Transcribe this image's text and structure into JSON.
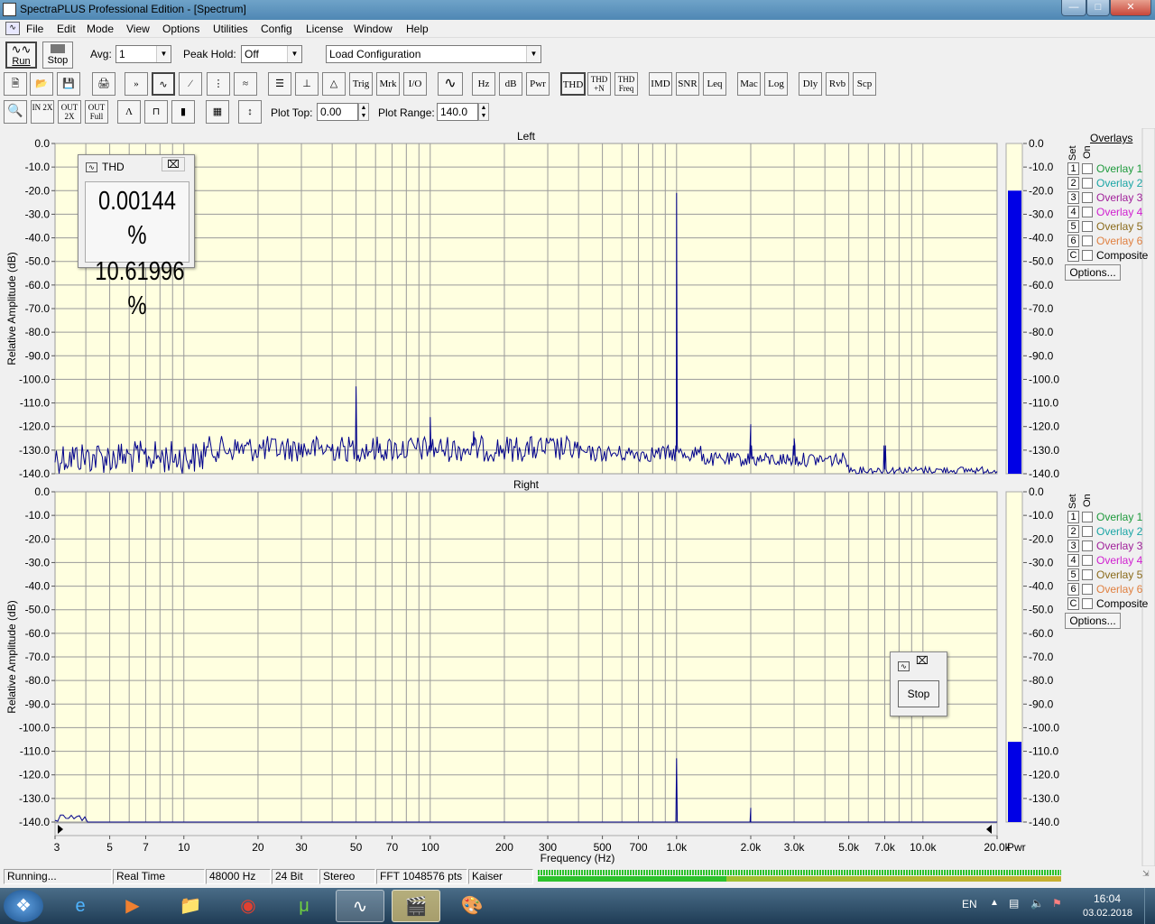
{
  "window": {
    "title": "SpectraPLUS Professional Edition - [Spectrum]"
  },
  "menu": [
    "File",
    "Edit",
    "Mode",
    "View",
    "Options",
    "Utilities",
    "Config",
    "License",
    "Window",
    "Help"
  ],
  "toolbar1": {
    "run_label": "Run",
    "stop_label": "Stop",
    "avg_label": "Avg:",
    "avg_value": "1",
    "peak_hold_label": "Peak Hold:",
    "peak_hold_value": "Off",
    "config_value": "Load Configuration"
  },
  "toolbar2": {
    "buttons": [
      "Trig",
      "Mrk",
      "I/O",
      "Hz",
      "dB",
      "Pwr",
      "THD",
      "THD +N",
      "THD Freq",
      "IMD",
      "SNR",
      "Leq",
      "Mac",
      "Log",
      "Dly",
      "Rvb",
      "Scp"
    ]
  },
  "toolbar3": {
    "zoom_labels": [
      "IN 2X",
      "OUT 2X",
      "OUT Full"
    ],
    "plot_top_label": "Plot Top:",
    "plot_top_value": "0.00",
    "plot_range_label": "Plot Range:",
    "plot_range_value": "140.0"
  },
  "plots": {
    "left_title": "Left",
    "right_title": "Right",
    "y_label": "Relative Amplitude (dB)",
    "x_label": "Frequency (Hz)",
    "pwr_label": "Pwr",
    "y_ticks": [
      "0.0",
      "-10.0",
      "-20.0",
      "-30.0",
      "-40.0",
      "-50.0",
      "-60.0",
      "-70.0",
      "-80.0",
      "-90.0",
      "-100.0",
      "-110.0",
      "-120.0",
      "-130.0",
      "-140.0"
    ],
    "x_ticks": [
      "3",
      "5",
      "7",
      "10",
      "20",
      "30",
      "50",
      "70",
      "100",
      "200",
      "300",
      "500",
      "700",
      "1.0k",
      "2.0k",
      "3.0k",
      "5.0k",
      "7.0k",
      "10.0k",
      "20.0k"
    ]
  },
  "chart_data": [
    {
      "type": "line",
      "title": "Left",
      "xlabel": "Frequency (Hz)",
      "ylabel": "Relative Amplitude (dB)",
      "xscale": "log",
      "xlim": [
        3,
        20000
      ],
      "ylim": [
        -140,
        0
      ],
      "grid": true,
      "series": [
        {
          "peaks": [
            [
              50,
              -103
            ],
            [
              100,
              -116
            ],
            [
              150,
              -122
            ],
            [
              1000,
              -21
            ],
            [
              2000,
              -119
            ],
            [
              3000,
              -125
            ],
            [
              7000,
              -136
            ]
          ],
          "floor_db": -130
        }
      ],
      "pwr_meter_db": -20
    },
    {
      "type": "line",
      "title": "Right",
      "xlabel": "Frequency (Hz)",
      "ylabel": "Relative Amplitude (dB)",
      "xscale": "log",
      "xlim": [
        3,
        20000
      ],
      "ylim": [
        -140,
        0
      ],
      "grid": true,
      "series": [
        {
          "peaks": [
            [
              1000,
              -113
            ],
            [
              2000,
              -134
            ]
          ],
          "floor_db": -140
        }
      ],
      "pwr_meter_db": -106
    }
  ],
  "overlays": {
    "header": "Overlays",
    "set_label": "Set",
    "on_label": "On",
    "items": [
      {
        "num": "1",
        "name": "Overlay 1",
        "color": "#1e9a3c"
      },
      {
        "num": "2",
        "name": "Overlay 2",
        "color": "#1aa5a5"
      },
      {
        "num": "3",
        "name": "Overlay 3",
        "color": "#a0209a"
      },
      {
        "num": "4",
        "name": "Overlay 4",
        "color": "#d020d0"
      },
      {
        "num": "5",
        "name": "Overlay 5",
        "color": "#8a6a1a"
      },
      {
        "num": "6",
        "name": "Overlay 6",
        "color": "#e08040"
      },
      {
        "num": "C",
        "name": "Composite",
        "color": "#000000"
      }
    ],
    "options_label": "Options..."
  },
  "thd_window": {
    "title": "THD",
    "value1": "0.00144 %",
    "value2": "10.61996 %"
  },
  "stop_window": {
    "button": "Stop"
  },
  "status": {
    "state": "Running...",
    "mode": "Real Time",
    "rate": "48000 Hz",
    "bits": "24 Bit",
    "channels": "Stereo",
    "fft": "FFT 1048576 pts",
    "window": "Kaiser"
  },
  "tray": {
    "lang": "EN",
    "time": "16:04",
    "date": "03.02.2018"
  }
}
